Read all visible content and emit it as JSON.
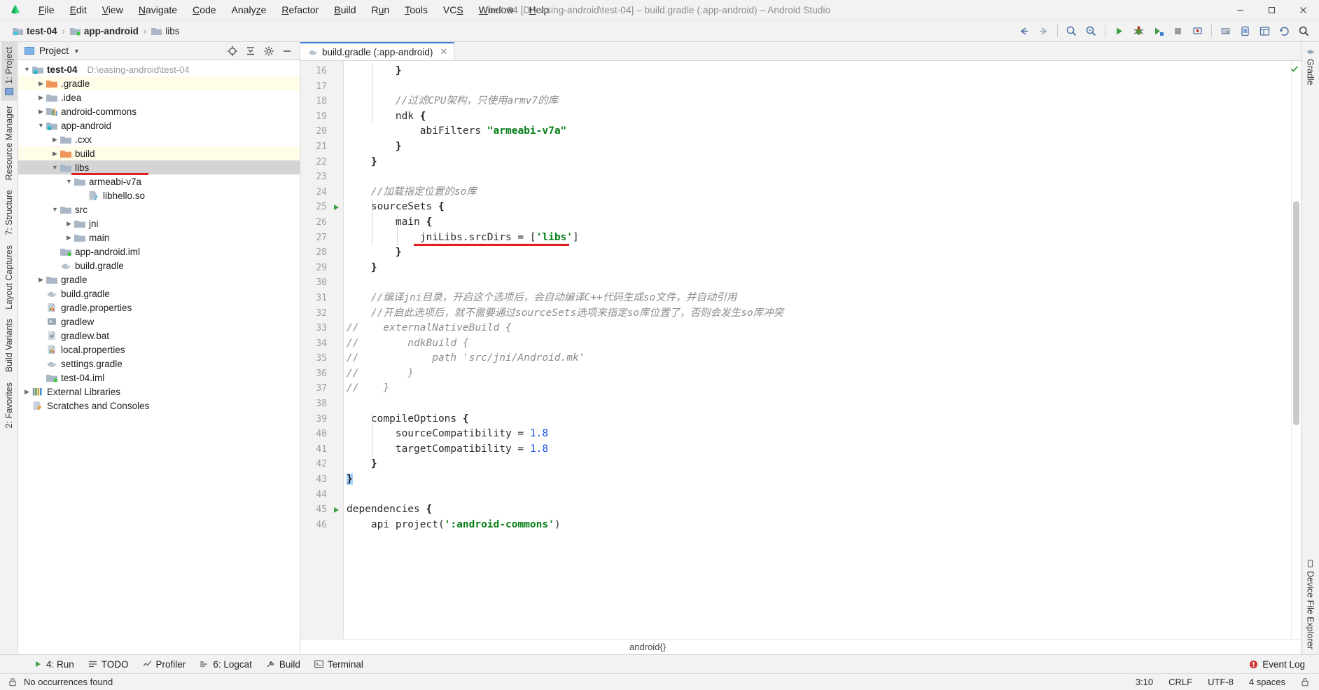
{
  "window": {
    "title": "test-04 [D:\\easing-android\\test-04] – build.gradle (:app-android) – Android Studio",
    "minimize": "–",
    "maximize": "▢",
    "close": "✕"
  },
  "menu": {
    "items": [
      {
        "label": "File",
        "accel": "F"
      },
      {
        "label": "Edit",
        "accel": "E"
      },
      {
        "label": "View",
        "accel": "V"
      },
      {
        "label": "Navigate",
        "accel": "N"
      },
      {
        "label": "Code",
        "accel": "C"
      },
      {
        "label": "Analyze",
        "accel": "z"
      },
      {
        "label": "Refactor",
        "accel": "R"
      },
      {
        "label": "Build",
        "accel": "B"
      },
      {
        "label": "Run",
        "accel": "u"
      },
      {
        "label": "Tools",
        "accel": "T"
      },
      {
        "label": "VCS",
        "accel": "S"
      },
      {
        "label": "Window",
        "accel": "W"
      },
      {
        "label": "Help",
        "accel": "H"
      }
    ]
  },
  "breadcrumb": {
    "items": [
      "test-04",
      "app-android",
      "libs"
    ],
    "separator": "›"
  },
  "project_panel": {
    "title": "Project",
    "dropdown_caret": "▾",
    "header_icons": [
      "locate-icon",
      "collapse-all-icon",
      "settings-gear-icon",
      "hide-icon"
    ],
    "tree": [
      {
        "depth": 0,
        "twist": "▼",
        "icon": "module-folder-icon",
        "label": "test-04",
        "bold": true,
        "path": "D:\\easing-android\\test-04",
        "state": "normal"
      },
      {
        "depth": 1,
        "twist": "▶",
        "icon": "folder-orange-icon",
        "label": ".gradle",
        "state": "excluded"
      },
      {
        "depth": 1,
        "twist": "▶",
        "icon": "folder-icon",
        "label": ".idea",
        "state": "normal"
      },
      {
        "depth": 1,
        "twist": "▶",
        "icon": "gradle-module-icon",
        "label": "android-commons",
        "state": "normal"
      },
      {
        "depth": 1,
        "twist": "▼",
        "icon": "module-folder-icon",
        "label": "app-android",
        "state": "normal"
      },
      {
        "depth": 2,
        "twist": "▶",
        "icon": "folder-icon",
        "label": ".cxx",
        "state": "normal"
      },
      {
        "depth": 2,
        "twist": "▶",
        "icon": "folder-orange-icon",
        "label": "build",
        "state": "excluded"
      },
      {
        "depth": 2,
        "twist": "▼",
        "icon": "folder-icon",
        "label": "libs",
        "state": "selected",
        "annotated": true
      },
      {
        "depth": 3,
        "twist": "▼",
        "icon": "folder-icon",
        "label": "armeabi-v7a",
        "state": "normal"
      },
      {
        "depth": 4,
        "twist": "",
        "icon": "unknown-file-icon",
        "label": "libhello.so",
        "state": "normal"
      },
      {
        "depth": 2,
        "twist": "▼",
        "icon": "folder-icon",
        "label": "src",
        "state": "normal"
      },
      {
        "depth": 3,
        "twist": "▶",
        "icon": "folder-icon",
        "label": "jni",
        "state": "normal"
      },
      {
        "depth": 3,
        "twist": "▶",
        "icon": "folder-icon",
        "label": "main",
        "state": "normal"
      },
      {
        "depth": 2,
        "twist": "",
        "icon": "iml-module-icon",
        "label": "app-android.iml",
        "state": "normal"
      },
      {
        "depth": 2,
        "twist": "",
        "icon": "gradle-file-icon",
        "label": "build.gradle",
        "state": "normal"
      },
      {
        "depth": 1,
        "twist": "▶",
        "icon": "folder-icon",
        "label": "gradle",
        "state": "normal"
      },
      {
        "depth": 1,
        "twist": "",
        "icon": "gradle-file-icon",
        "label": "build.gradle",
        "state": "normal"
      },
      {
        "depth": 1,
        "twist": "",
        "icon": "properties-file-icon",
        "label": "gradle.properties",
        "state": "normal"
      },
      {
        "depth": 1,
        "twist": "",
        "icon": "script-file-icon",
        "label": "gradlew",
        "state": "normal"
      },
      {
        "depth": 1,
        "twist": "",
        "icon": "bat-file-icon",
        "label": "gradlew.bat",
        "state": "normal"
      },
      {
        "depth": 1,
        "twist": "",
        "icon": "properties-file-icon",
        "label": "local.properties",
        "state": "normal"
      },
      {
        "depth": 1,
        "twist": "",
        "icon": "gradle-file-icon",
        "label": "settings.gradle",
        "state": "normal"
      },
      {
        "depth": 1,
        "twist": "",
        "icon": "iml-module-icon",
        "label": "test-04.iml",
        "state": "normal"
      },
      {
        "depth": 0,
        "twist": "▶",
        "icon": "external-libraries-icon",
        "label": "External Libraries",
        "state": "normal"
      },
      {
        "depth": 0,
        "twist": "",
        "icon": "scratches-icon",
        "label": "Scratches and Consoles",
        "state": "normal"
      }
    ]
  },
  "editor": {
    "tab": {
      "label": "build.gradle (:app-android)",
      "icon": "gradle-file-icon",
      "close": "✕"
    },
    "first_line_number": 16,
    "lines": [
      {
        "n": 16,
        "indent": 2,
        "text": "}",
        "type": "code",
        "fold": false
      },
      {
        "n": 17,
        "indent": 0,
        "text": "",
        "type": "blank",
        "fold": false
      },
      {
        "n": 18,
        "indent": 2,
        "text": "//过滤CPU架构，只使用armv7的库",
        "type": "comment",
        "fold": false
      },
      {
        "n": 19,
        "indent": 2,
        "text": "ndk {",
        "type": "code",
        "fold": false
      },
      {
        "n": 20,
        "indent": 3,
        "text": "abiFilters \"armeabi-v7a\"",
        "type": "code",
        "fold": false
      },
      {
        "n": 21,
        "indent": 2,
        "text": "}",
        "type": "code",
        "fold": false
      },
      {
        "n": 22,
        "indent": 1,
        "text": "}",
        "type": "code",
        "fold": false
      },
      {
        "n": 23,
        "indent": 0,
        "text": "",
        "type": "blank",
        "fold": false
      },
      {
        "n": 24,
        "indent": 1,
        "text": "//加载指定位置的so库",
        "type": "comment",
        "fold": false
      },
      {
        "n": 25,
        "indent": 1,
        "text": "sourceSets {",
        "type": "code",
        "fold": true
      },
      {
        "n": 26,
        "indent": 2,
        "text": "main {",
        "type": "code",
        "fold": false
      },
      {
        "n": 27,
        "indent": 3,
        "text": "jniLibs.srcDirs = ['libs']",
        "type": "code",
        "fold": false,
        "annotated": true
      },
      {
        "n": 28,
        "indent": 2,
        "text": "}",
        "type": "code",
        "fold": false
      },
      {
        "n": 29,
        "indent": 1,
        "text": "}",
        "type": "code",
        "fold": false
      },
      {
        "n": 30,
        "indent": 0,
        "text": "",
        "type": "blank",
        "fold": false
      },
      {
        "n": 31,
        "indent": 1,
        "text": "//编译jni目录，开启这个选项后，会自动编译C++代码生成so文件，并自动引用",
        "type": "comment",
        "fold": false
      },
      {
        "n": 32,
        "indent": 1,
        "text": "//开启此选项后，就不需要通过sourceSets选项来指定so库位置了，否则会发生so库冲突",
        "type": "comment",
        "fold": false
      },
      {
        "n": 33,
        "indent": 0,
        "text": "//    externalNativeBuild {",
        "type": "comment",
        "fold": false
      },
      {
        "n": 34,
        "indent": 0,
        "text": "//        ndkBuild {",
        "type": "comment",
        "fold": false
      },
      {
        "n": 35,
        "indent": 0,
        "text": "//            path 'src/jni/Android.mk'",
        "type": "comment",
        "fold": false
      },
      {
        "n": 36,
        "indent": 0,
        "text": "//        }",
        "type": "comment",
        "fold": false
      },
      {
        "n": 37,
        "indent": 0,
        "text": "//    }",
        "type": "comment",
        "fold": false
      },
      {
        "n": 38,
        "indent": 0,
        "text": "",
        "type": "blank",
        "fold": false
      },
      {
        "n": 39,
        "indent": 1,
        "text": "compileOptions {",
        "type": "code",
        "fold": false
      },
      {
        "n": 40,
        "indent": 2,
        "text": "sourceCompatibility = 1.8",
        "type": "code",
        "fold": false
      },
      {
        "n": 41,
        "indent": 2,
        "text": "targetCompatibility = 1.8",
        "type": "code",
        "fold": false
      },
      {
        "n": 42,
        "indent": 1,
        "text": "}",
        "type": "code",
        "fold": false
      },
      {
        "n": 43,
        "indent": 0,
        "text": "}",
        "type": "code",
        "fold": false,
        "caret": true
      },
      {
        "n": 44,
        "indent": 0,
        "text": "",
        "type": "blank",
        "fold": false
      },
      {
        "n": 45,
        "indent": 0,
        "text": "dependencies {",
        "type": "code",
        "fold": true
      },
      {
        "n": 46,
        "indent": 1,
        "text": "api project(':android-commons')",
        "type": "code",
        "fold": false
      }
    ],
    "bottom_breadcrumb": "android{}",
    "inspection_status": "ok-check-icon"
  },
  "left_rail": {
    "tabs": [
      {
        "label": "1: Project",
        "selected": true,
        "icon": "project-icon"
      },
      {
        "label": "Resource Manager",
        "selected": false,
        "icon": "resource-icon"
      },
      {
        "label": "7: Structure",
        "selected": false,
        "icon": "structure-icon"
      },
      {
        "label": "Layout Captures",
        "selected": false,
        "icon": "capture-icon"
      },
      {
        "label": "Build Variants",
        "selected": false,
        "icon": "variants-icon"
      },
      {
        "label": "2: Favorites",
        "selected": false,
        "icon": "favorites-icon"
      }
    ]
  },
  "right_rail": {
    "tabs": [
      {
        "label": "Gradle",
        "icon": "gradle-icon"
      },
      {
        "label": "Device File Explorer",
        "icon": "device-icon"
      }
    ]
  },
  "bottom_tools": {
    "items": [
      {
        "label": "4: Run",
        "icon": "run-icon"
      },
      {
        "label": "TODO",
        "icon": "todo-icon"
      },
      {
        "label": "Profiler",
        "icon": "profiler-icon"
      },
      {
        "label": "6: Logcat",
        "icon": "logcat-icon"
      },
      {
        "label": "Build",
        "icon": "build-icon"
      },
      {
        "label": "Terminal",
        "icon": "terminal-icon"
      }
    ],
    "event_log": {
      "label": "Event Log",
      "icon": "event-log-icon"
    }
  },
  "statusbar": {
    "message": "No occurrences found",
    "caret_position": "3:10",
    "line_separator": "CRLF",
    "encoding": "UTF-8",
    "indent": "4 spaces",
    "lock_icon": "lock-icon"
  },
  "toolbar_right": {
    "icons": [
      "back-arrow-icon",
      "forward-arrow-icon",
      "search-everywhere-icon",
      "find-icon",
      "run-icon",
      "debug-icon",
      "run-coverage-icon",
      "stop-icon",
      "attach-debugger-icon",
      "sdk-manager-icon",
      "avd-manager-icon",
      "layout-inspector-icon",
      "sync-gradle-icon",
      "search-icon"
    ]
  },
  "colors": {
    "accent_blue": "#3c7fd0",
    "annotation_red": "#e02020",
    "string_green": "#067d17",
    "number_blue": "#1750eb",
    "comment_gray": "#8c8c8c",
    "selection_gray": "#d4d4d4",
    "excluded_yellow": "#fffce8"
  }
}
